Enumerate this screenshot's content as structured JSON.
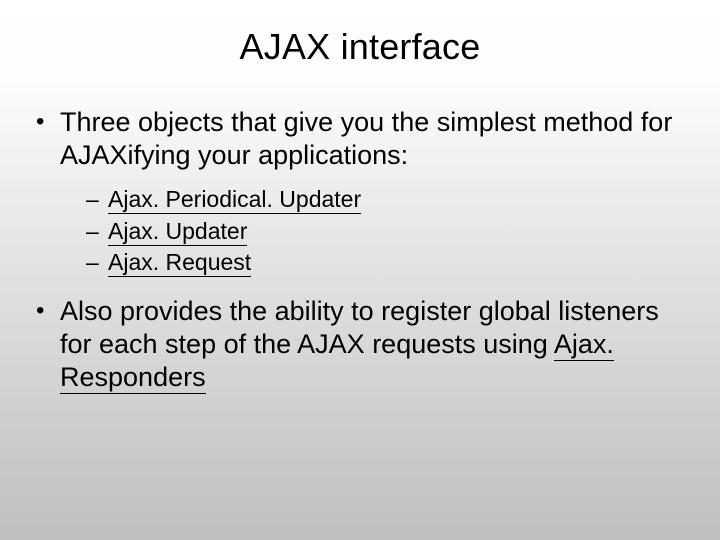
{
  "title": "AJAX interface",
  "bullets": [
    {
      "text": "Three objects that give you the simplest method for AJAXifying your applications:",
      "sub": [
        "Ajax. Periodical. Updater",
        "Ajax. Updater",
        "Ajax. Request"
      ]
    },
    {
      "text_before": "Also provides the ability to register global listeners for each step of the AJAX requests using ",
      "text_underlined": "Ajax. Responders"
    }
  ]
}
